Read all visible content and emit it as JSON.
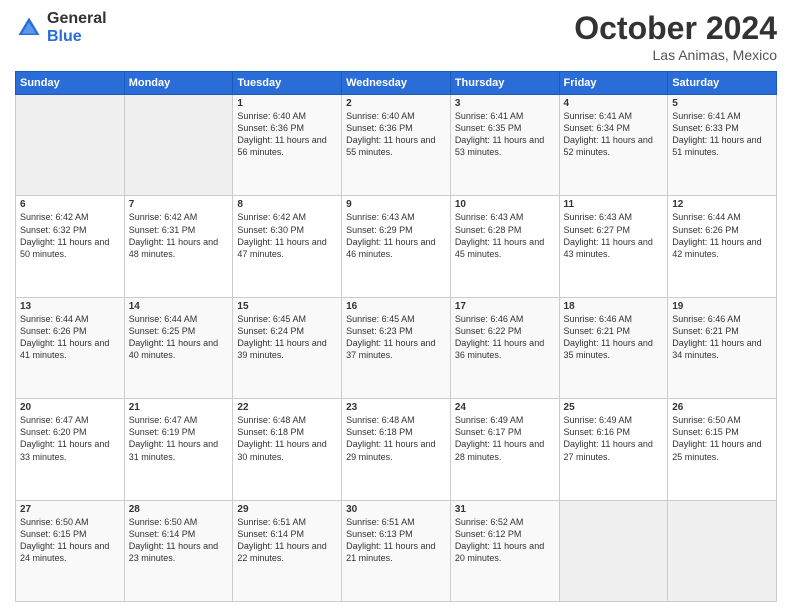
{
  "logo": {
    "general": "General",
    "blue": "Blue"
  },
  "header": {
    "month": "October 2024",
    "location": "Las Animas, Mexico"
  },
  "days_of_week": [
    "Sunday",
    "Monday",
    "Tuesday",
    "Wednesday",
    "Thursday",
    "Friday",
    "Saturday"
  ],
  "weeks": [
    [
      {
        "day": "",
        "empty": true
      },
      {
        "day": "",
        "empty": true
      },
      {
        "day": "1",
        "sunrise": "6:40 AM",
        "sunset": "6:36 PM",
        "daylight": "11 hours and 56 minutes."
      },
      {
        "day": "2",
        "sunrise": "6:40 AM",
        "sunset": "6:36 PM",
        "daylight": "11 hours and 55 minutes."
      },
      {
        "day": "3",
        "sunrise": "6:41 AM",
        "sunset": "6:35 PM",
        "daylight": "11 hours and 53 minutes."
      },
      {
        "day": "4",
        "sunrise": "6:41 AM",
        "sunset": "6:34 PM",
        "daylight": "11 hours and 52 minutes."
      },
      {
        "day": "5",
        "sunrise": "6:41 AM",
        "sunset": "6:33 PM",
        "daylight": "11 hours and 51 minutes."
      }
    ],
    [
      {
        "day": "6",
        "sunrise": "6:42 AM",
        "sunset": "6:32 PM",
        "daylight": "11 hours and 50 minutes."
      },
      {
        "day": "7",
        "sunrise": "6:42 AM",
        "sunset": "6:31 PM",
        "daylight": "11 hours and 48 minutes."
      },
      {
        "day": "8",
        "sunrise": "6:42 AM",
        "sunset": "6:30 PM",
        "daylight": "11 hours and 47 minutes."
      },
      {
        "day": "9",
        "sunrise": "6:43 AM",
        "sunset": "6:29 PM",
        "daylight": "11 hours and 46 minutes."
      },
      {
        "day": "10",
        "sunrise": "6:43 AM",
        "sunset": "6:28 PM",
        "daylight": "11 hours and 45 minutes."
      },
      {
        "day": "11",
        "sunrise": "6:43 AM",
        "sunset": "6:27 PM",
        "daylight": "11 hours and 43 minutes."
      },
      {
        "day": "12",
        "sunrise": "6:44 AM",
        "sunset": "6:26 PM",
        "daylight": "11 hours and 42 minutes."
      }
    ],
    [
      {
        "day": "13",
        "sunrise": "6:44 AM",
        "sunset": "6:26 PM",
        "daylight": "11 hours and 41 minutes."
      },
      {
        "day": "14",
        "sunrise": "6:44 AM",
        "sunset": "6:25 PM",
        "daylight": "11 hours and 40 minutes."
      },
      {
        "day": "15",
        "sunrise": "6:45 AM",
        "sunset": "6:24 PM",
        "daylight": "11 hours and 39 minutes."
      },
      {
        "day": "16",
        "sunrise": "6:45 AM",
        "sunset": "6:23 PM",
        "daylight": "11 hours and 37 minutes."
      },
      {
        "day": "17",
        "sunrise": "6:46 AM",
        "sunset": "6:22 PM",
        "daylight": "11 hours and 36 minutes."
      },
      {
        "day": "18",
        "sunrise": "6:46 AM",
        "sunset": "6:21 PM",
        "daylight": "11 hours and 35 minutes."
      },
      {
        "day": "19",
        "sunrise": "6:46 AM",
        "sunset": "6:21 PM",
        "daylight": "11 hours and 34 minutes."
      }
    ],
    [
      {
        "day": "20",
        "sunrise": "6:47 AM",
        "sunset": "6:20 PM",
        "daylight": "11 hours and 33 minutes."
      },
      {
        "day": "21",
        "sunrise": "6:47 AM",
        "sunset": "6:19 PM",
        "daylight": "11 hours and 31 minutes."
      },
      {
        "day": "22",
        "sunrise": "6:48 AM",
        "sunset": "6:18 PM",
        "daylight": "11 hours and 30 minutes."
      },
      {
        "day": "23",
        "sunrise": "6:48 AM",
        "sunset": "6:18 PM",
        "daylight": "11 hours and 29 minutes."
      },
      {
        "day": "24",
        "sunrise": "6:49 AM",
        "sunset": "6:17 PM",
        "daylight": "11 hours and 28 minutes."
      },
      {
        "day": "25",
        "sunrise": "6:49 AM",
        "sunset": "6:16 PM",
        "daylight": "11 hours and 27 minutes."
      },
      {
        "day": "26",
        "sunrise": "6:50 AM",
        "sunset": "6:15 PM",
        "daylight": "11 hours and 25 minutes."
      }
    ],
    [
      {
        "day": "27",
        "sunrise": "6:50 AM",
        "sunset": "6:15 PM",
        "daylight": "11 hours and 24 minutes."
      },
      {
        "day": "28",
        "sunrise": "6:50 AM",
        "sunset": "6:14 PM",
        "daylight": "11 hours and 23 minutes."
      },
      {
        "day": "29",
        "sunrise": "6:51 AM",
        "sunset": "6:14 PM",
        "daylight": "11 hours and 22 minutes."
      },
      {
        "day": "30",
        "sunrise": "6:51 AM",
        "sunset": "6:13 PM",
        "daylight": "11 hours and 21 minutes."
      },
      {
        "day": "31",
        "sunrise": "6:52 AM",
        "sunset": "6:12 PM",
        "daylight": "11 hours and 20 minutes."
      },
      {
        "day": "",
        "empty": true
      },
      {
        "day": "",
        "empty": true
      }
    ]
  ]
}
